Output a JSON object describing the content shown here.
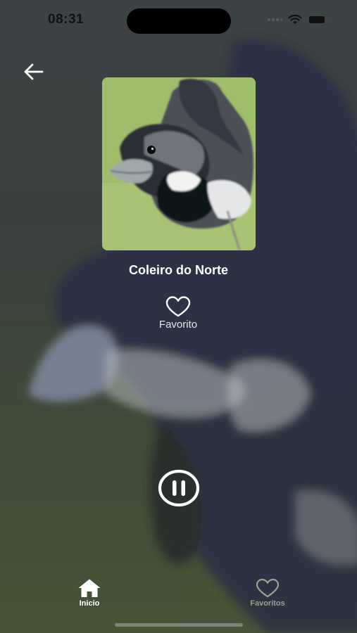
{
  "status_bar": {
    "time": "08:31"
  },
  "navigation": {
    "back_icon": "arrow-left-icon"
  },
  "player": {
    "cover_art": "bird-photo",
    "title": "Coleiro do Norte",
    "favorite_icon": "heart-outline-icon",
    "favorite_label": "Favorito",
    "playback_icon": "pause-circle-icon"
  },
  "tab_bar": {
    "tabs": [
      {
        "label": "Inicio",
        "icon": "home-icon",
        "active": true
      },
      {
        "label": "Favoritos",
        "icon": "heart-outline-icon",
        "active": false
      }
    ]
  },
  "colors": {
    "text_primary": "#ffffff",
    "tab_inactive": "#9aa08f",
    "status_text": "#111111"
  }
}
